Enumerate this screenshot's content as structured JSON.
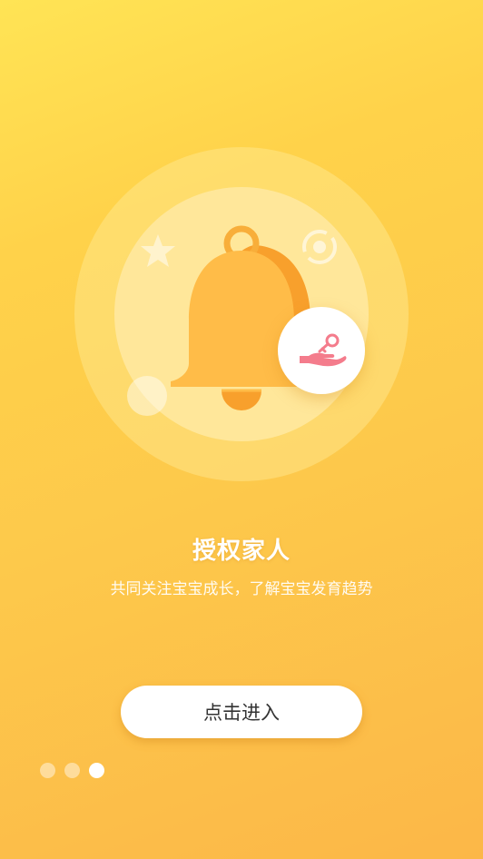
{
  "onboarding": {
    "title": "授权家人",
    "subtitle": "共同关注宝宝成长，了解宝宝发育趋势",
    "enter_button_label": "点击进入",
    "page_count": 3,
    "current_page": 3
  },
  "illustration": {
    "main_icon": "bell-icon",
    "badge_icon": "hand-key-icon",
    "decor_icons": [
      "star-icon",
      "target-ring-icon",
      "circle-icon"
    ]
  },
  "colors": {
    "gradient_top": "#FFE455",
    "gradient_bottom": "#FCB748",
    "bell": "#FFBC48",
    "bell_shadow": "#F8A02C",
    "badge_icon": "#F47C8C",
    "button_text": "#333333"
  }
}
